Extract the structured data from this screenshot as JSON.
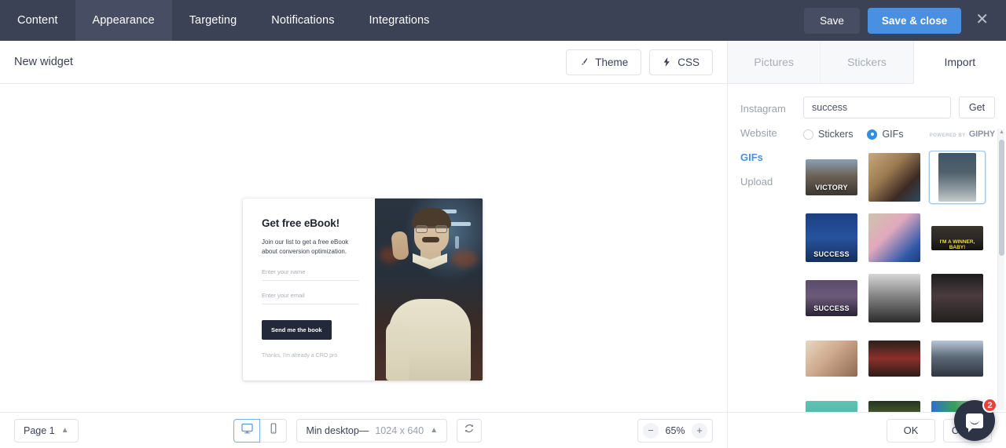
{
  "topnav": {
    "tabs": [
      {
        "label": "Content",
        "active": false
      },
      {
        "label": "Appearance",
        "active": true
      },
      {
        "label": "Targeting",
        "active": false
      },
      {
        "label": "Notifications",
        "active": false
      },
      {
        "label": "Integrations",
        "active": false
      }
    ],
    "save_label": "Save",
    "save_close_label": "Save & close",
    "close_icon": "close-icon",
    "bg_color": "#3b4256",
    "accent_color": "#4a90e2"
  },
  "editor_header": {
    "title": "New widget",
    "theme_button": "Theme",
    "css_button": "CSS",
    "theme_icon": "brush-icon",
    "css_icon": "lightning-icon"
  },
  "widget_preview": {
    "heading": "Get free eBook!",
    "subtext": "Join our list to get a free eBook about conversion optimization.",
    "name_placeholder": "Enter your name",
    "email_placeholder": "Enter your email",
    "submit_label": "Send me the book",
    "decline_label": "Thanks, I'm already a CRO pro",
    "image_alt": "napoleon-dynamite-gif"
  },
  "bottombar": {
    "page_selector": "Page 1",
    "page_caret": "chevron-up-icon",
    "device_desktop_icon": "desktop-icon",
    "device_mobile_icon": "mobile-icon",
    "device_active": "desktop",
    "viewport_label": "Min desktop—",
    "viewport_size": "1024 x 640",
    "viewport_caret": "chevron-up-icon",
    "refresh_icon": "refresh-icon",
    "zoom_out": "−",
    "zoom_value": "65%",
    "zoom_in": "+"
  },
  "rightpanel": {
    "tabs": [
      {
        "label": "Pictures",
        "active": false
      },
      {
        "label": "Stickers",
        "active": false
      },
      {
        "label": "Import",
        "active": true
      }
    ],
    "sources": [
      {
        "label": "Instagram",
        "active": false
      },
      {
        "label": "Website",
        "active": false
      },
      {
        "label": "GIFs",
        "active": true
      },
      {
        "label": "Upload",
        "active": false
      }
    ],
    "search_value": "success",
    "search_placeholder": "success",
    "get_button": "Get",
    "radio_stickers": "Stickers",
    "radio_gifs": "GIFs",
    "radio_selected": "GIFs",
    "brand_prefix": "POWERED BY",
    "brand_name": "GIPHY",
    "results": [
      {
        "caption": "VICTORY",
        "shape": "short",
        "selected": false
      },
      {
        "caption": "",
        "shape": "full",
        "selected": false
      },
      {
        "caption": "",
        "shape": "tall",
        "selected": true
      },
      {
        "caption": "SUCCESS",
        "shape": "full",
        "selected": false
      },
      {
        "caption": "",
        "shape": "full",
        "selected": false
      },
      {
        "caption": "I'M A WINNER, BABY!",
        "shape": "vshort",
        "selected": false
      },
      {
        "caption": "SUCCESS",
        "shape": "short",
        "selected": false
      },
      {
        "caption": "",
        "shape": "full",
        "selected": false
      },
      {
        "caption": "",
        "shape": "full",
        "selected": false
      },
      {
        "caption": "",
        "shape": "short",
        "selected": false
      },
      {
        "caption": "",
        "shape": "short",
        "selected": false
      },
      {
        "caption": "",
        "shape": "short",
        "selected": false
      },
      {
        "caption": "",
        "shape": "short",
        "selected": false
      },
      {
        "caption": "",
        "shape": "short",
        "selected": false
      },
      {
        "caption": "",
        "shape": "short",
        "selected": false
      }
    ],
    "ok_button": "OK",
    "cancel_button": "Cancel"
  },
  "intercom": {
    "badge_count": "2",
    "icon": "chat-icon"
  }
}
